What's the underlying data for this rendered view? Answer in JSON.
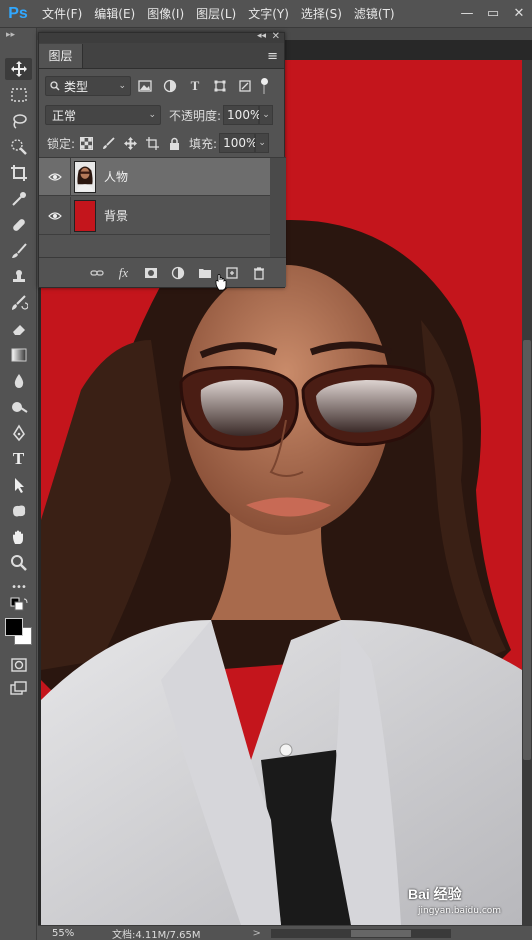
{
  "app": {
    "logo": "Ps",
    "menu": [
      "文件(F)",
      "编辑(E)",
      "图像(I)",
      "图层(L)",
      "文字(Y)",
      "选择(S)",
      "滤镜(T)"
    ],
    "window_buttons": {
      "minimize": "—",
      "restore": "▭",
      "close": "✕"
    }
  },
  "toolbar": {
    "tools": [
      "move-tool",
      "marquee-tool",
      "lasso-tool",
      "quick-selection-tool",
      "crop-tool",
      "eyedropper-tool",
      "healing-brush-tool",
      "brush-tool",
      "clone-stamp-tool",
      "history-brush-tool",
      "eraser-tool",
      "gradient-tool",
      "blur-tool",
      "dodge-tool",
      "pen-tool",
      "type-tool",
      "path-selection-tool",
      "custom-shape-tool",
      "hand-tool",
      "zoom-tool",
      "more-tools",
      "default-colors",
      "swap-colors",
      "foreground-color",
      "background-color",
      "quick-mask",
      "screen-mode"
    ],
    "type_glyph": "T",
    "more_glyph": "•••",
    "foreground_color": "#000000",
    "background_color": "#ffffff"
  },
  "layers_panel": {
    "tab_label": "图层",
    "filter": {
      "label": "类型",
      "icons": [
        "image-filter-icon",
        "adjustment-filter-icon",
        "type-filter-icon",
        "shape-filter-icon",
        "smart-object-filter-icon"
      ]
    },
    "blend_mode": "正常",
    "opacity_label": "不透明度:",
    "opacity_value": "100%",
    "lock_label": "锁定:",
    "fill_label": "填充:",
    "fill_value": "100%",
    "layers": [
      {
        "name": "人物",
        "visible": true,
        "selected": true,
        "thumb": "person-thumbnail"
      },
      {
        "name": "背景",
        "visible": true,
        "selected": false,
        "thumb": "red-fill-thumbnail",
        "color": "#c4151c"
      }
    ],
    "footer_icons": [
      "link-layers-icon",
      "fx-icon",
      "layer-mask-icon",
      "adjustment-layer-icon",
      "group-folder-icon",
      "new-layer-icon",
      "delete-layer-icon"
    ],
    "fx_label": "fx"
  },
  "canvas": {
    "background_color": "#c4151c"
  },
  "status": {
    "zoom": "55%",
    "doc_info": "文档:4.11M/7.65M",
    "arrow": ">"
  },
  "watermark": {
    "brand": "Bai 经验",
    "url": "jingyan.baidu.com"
  }
}
